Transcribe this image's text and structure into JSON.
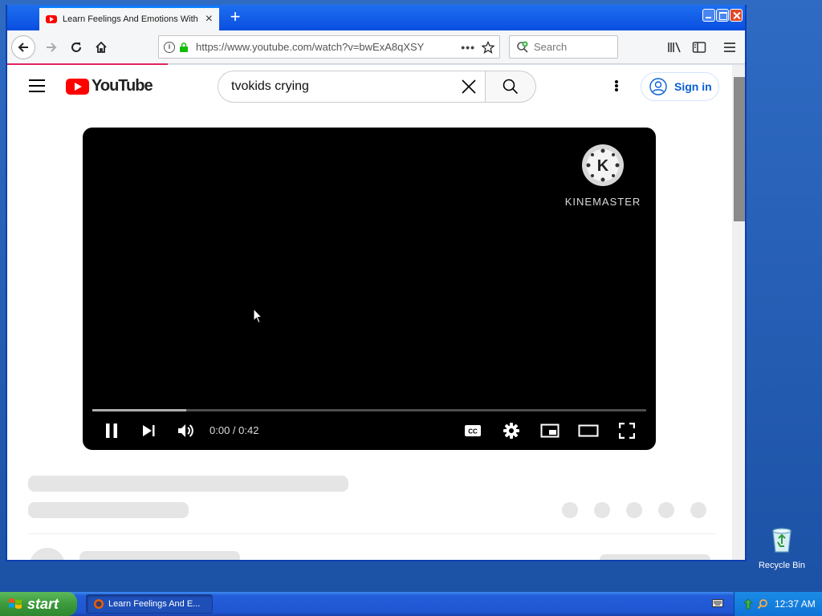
{
  "browser": {
    "tab_title": "Learn Feelings And Emotions With",
    "new_tab_glyph": "+",
    "url": "https://www.youtube.com/watch?v=bwExA8qXSY",
    "url_actions_glyph": "•••",
    "search_placeholder": "Search"
  },
  "youtube": {
    "logo_text": "YouTube",
    "search_query": "tvokids crying",
    "sign_in_label": "Sign in"
  },
  "player": {
    "watermark": "KINEMASTER",
    "watermark_letter": "K",
    "time_display": "0:00 / 0:42",
    "played_fraction": 0.0,
    "buffered_fraction": 0.17,
    "cc_label": "CC"
  },
  "desktop": {
    "recycle_bin_label": "Recycle Bin"
  },
  "taskbar": {
    "start_label": "start",
    "task_item_label": "Learn Feelings And E...",
    "clock": "12:37 AM"
  },
  "colors": {
    "youtube_red": "#ff0000",
    "signin_blue": "#065fd4",
    "xp_blue": "#245edb",
    "start_green": "#3c9a3c"
  }
}
